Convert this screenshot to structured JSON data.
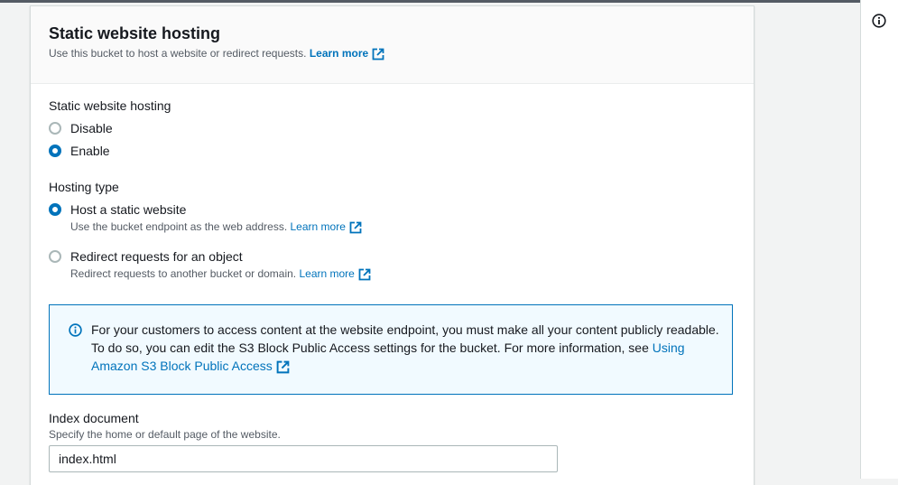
{
  "panel": {
    "title": "Static website hosting",
    "subtitle": "Use this bucket to host a website or redirect requests.",
    "learn_more": "Learn more"
  },
  "hosting": {
    "label": "Static website hosting",
    "options": [
      {
        "label": "Disable",
        "selected": false
      },
      {
        "label": "Enable",
        "selected": true
      }
    ]
  },
  "hosting_type": {
    "label": "Hosting type",
    "options": [
      {
        "label": "Host a static website",
        "description": "Use the bucket endpoint as the web address.",
        "link": "Learn more",
        "selected": true
      },
      {
        "label": "Redirect requests for an object",
        "description": "Redirect requests to another bucket or domain.",
        "link": "Learn more",
        "selected": false
      }
    ]
  },
  "alert": {
    "text": "For your customers to access content at the website endpoint, you must make all your content publicly readable. To do so, you can edit the S3 Block Public Access settings for the bucket. For more information, see",
    "link": "Using Amazon S3 Block Public Access"
  },
  "index_document": {
    "label": "Index document",
    "description": "Specify the home or default page of the website.",
    "value": "index.html"
  },
  "icons": {
    "external": "external-link-icon",
    "info": "info-circle-icon"
  },
  "colors": {
    "accent": "#0073bb",
    "info_bg": "#f1faff",
    "text": "#16191f",
    "muted": "#545b64"
  }
}
